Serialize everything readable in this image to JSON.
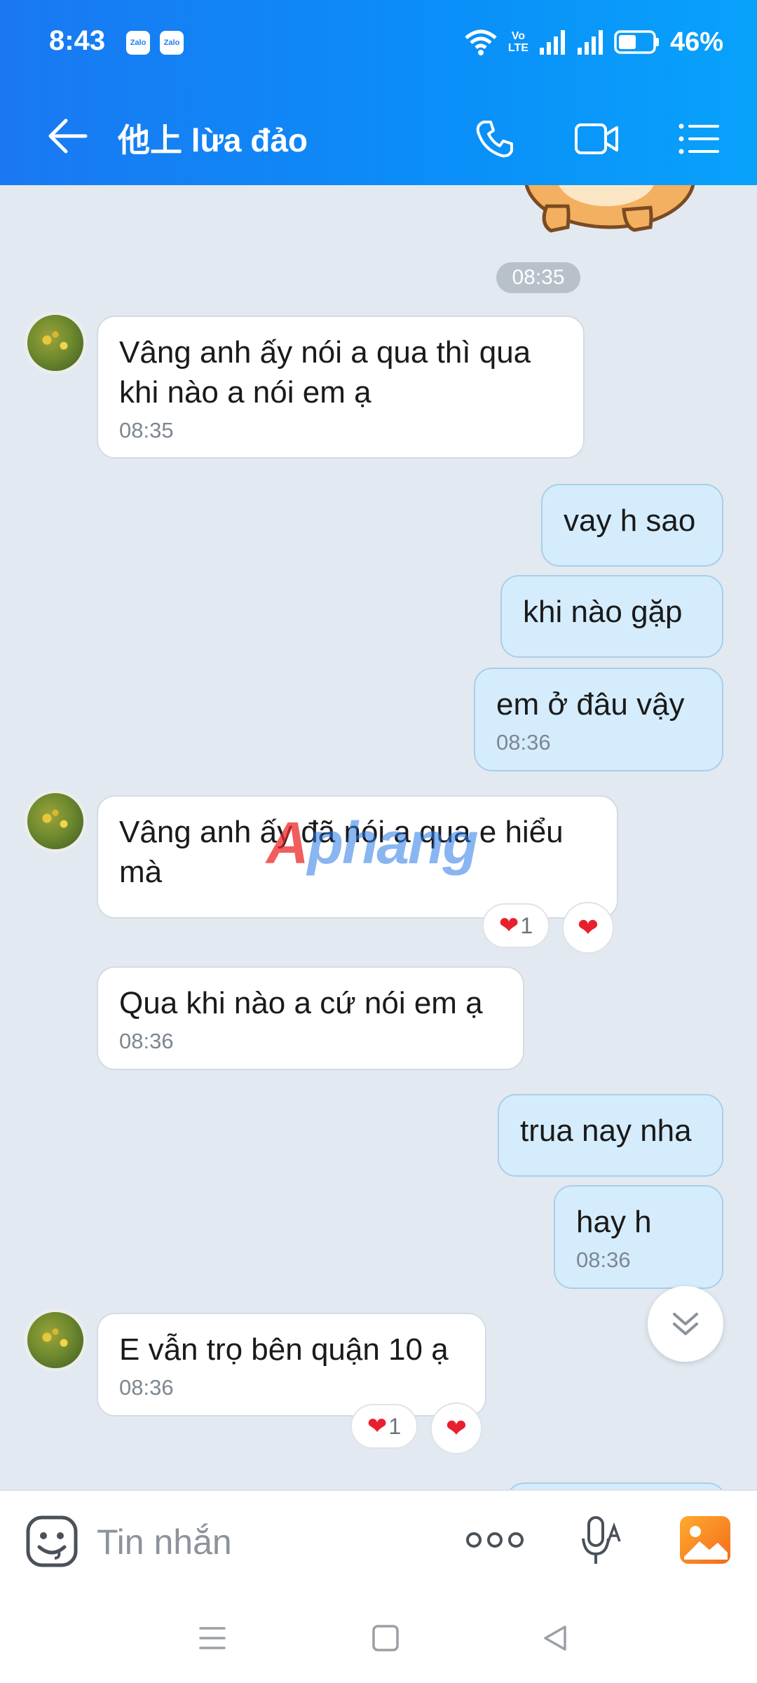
{
  "status_bar": {
    "time": "8:43",
    "notif_1": "Zalo",
    "notif_2": "Zalo",
    "volte_top": "Vo",
    "volte_bottom": "LTE",
    "battery": "46%"
  },
  "header": {
    "title": "他上 lừa đảo"
  },
  "chat": {
    "time_pill": "08:35",
    "messages": [
      {
        "dir": "in",
        "text": "Vâng anh ấy nói a qua thì qua khi nào a nói em ạ",
        "time": "08:35"
      },
      {
        "dir": "out",
        "text": "vay h sao"
      },
      {
        "dir": "out",
        "text": "khi nào gặp"
      },
      {
        "dir": "out",
        "text": "em ở đâu vậy",
        "time": "08:36"
      },
      {
        "dir": "in",
        "text": "Vâng anh ấy đã nói a qua e hiểu mà",
        "reaction_count": "1"
      },
      {
        "dir": "in",
        "text": "Qua khi nào a cứ nói em ạ",
        "time": "08:36"
      },
      {
        "dir": "out",
        "text": "trua nay nha"
      },
      {
        "dir": "out",
        "text": "hay h",
        "time": "08:36"
      },
      {
        "dir": "in",
        "text": "E vẫn trọ bên quận 10 ạ",
        "time": "08:36",
        "reaction_count": "1"
      }
    ],
    "watermark": {
      "prefix": "A",
      "rest": "phang"
    }
  },
  "input": {
    "placeholder": "Tin nhắn"
  },
  "colors": {
    "header": "#1a78f2",
    "chat_bg": "#e2e9f1",
    "out_bubble": "#d5ecfd",
    "in_bubble": "#ffffff"
  },
  "icons": [
    "back-arrow-icon",
    "phone-icon",
    "video-call-icon",
    "menu-list-icon",
    "emoji-icon",
    "more-dots-icon",
    "voice-mic-icon",
    "image-gallery-icon",
    "scroll-down-icon",
    "heart-icon"
  ]
}
